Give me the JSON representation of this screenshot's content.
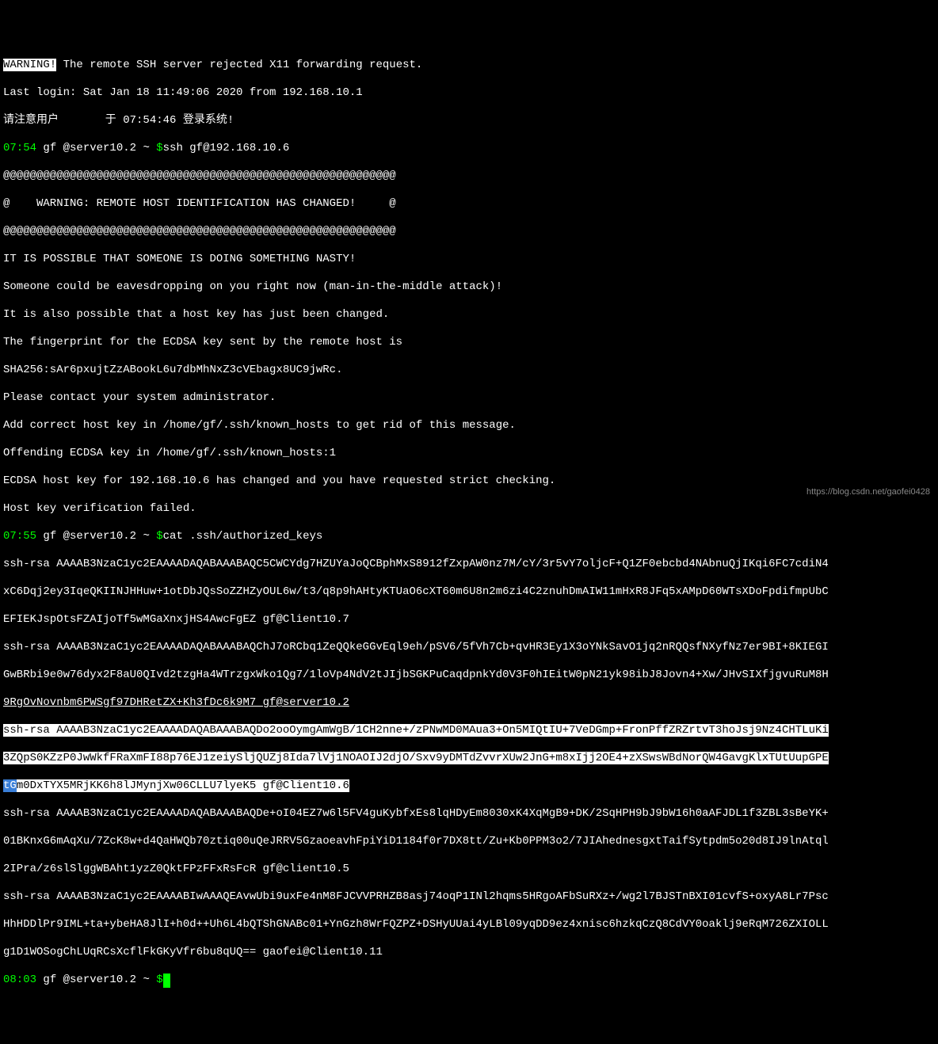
{
  "line1": {
    "warning": "WARNING!",
    "text": " The remote SSH server rejected X11 forwarding request."
  },
  "line2": "Last login: Sat Jan 18 11:49:06 2020 from 192.168.10.1",
  "line3": "请注意用户       于 07:54:46 登录系统!",
  "prompt1": {
    "time": "07:54",
    "user": " gf @server10.2 ~ ",
    "dollar": "$",
    "cmd": "ssh gf@192.168.10.6"
  },
  "warn1": "@@@@@@@@@@@@@@@@@@@@@@@@@@@@@@@@@@@@@@@@@@@@@@@@@@@@@@@@@@@",
  "warn2": "@    WARNING: REMOTE HOST IDENTIFICATION HAS CHANGED!     @",
  "warn3": "@@@@@@@@@@@@@@@@@@@@@@@@@@@@@@@@@@@@@@@@@@@@@@@@@@@@@@@@@@@",
  "msg1": "IT IS POSSIBLE THAT SOMEONE IS DOING SOMETHING NASTY!",
  "msg2": "Someone could be eavesdropping on you right now (man-in-the-middle attack)!",
  "msg3": "It is also possible that a host key has just been changed.",
  "msg4": "The fingerprint for the ECDSA key sent by the remote host is",
  "msg5": "SHA256:sAr6pxujtZzABookL6u7dbMhNxZ3cVEbagx8UC9jwRc.",
  "msg6": "Please contact your system administrator.",
  "msg7": "Add correct host key in /home/gf/.ssh/known_hosts to get rid of this message.",
  "msg8": "Offending ECDSA key in /home/gf/.ssh/known_hosts:1",
  "msg9": "ECDSA host key for 192.168.10.6 has changed and you have requested strict checking.",
  "msg10": "Host key verification failed.",
  "prompt2": {
    "time": "07:55",
    "user": " gf @server10.2 ~ ",
    "dollar": "$",
    "cmd": "cat .ssh/authorized_keys"
  },
  "key1a": "ssh-rsa AAAAB3NzaC1yc2EAAAADAQABAAABAQC5CWCYdg7HZUYaJoQCBphMxS8912fZxpAW0nz7M/cY/3r5vY7oljcF+Q1ZF0ebcbd4NAbnuQjIKqi6FC7cdiN4",
  "key1b": "xC6Dqj2ey3IqeQKIINJHHuw+1otDbJQsSoZZHZyOUL6w/t3/q8p9hAHtyKTUaO6cXT60m6U8n2m6zi4C2znuhDmAIW11mHxR8JFq5xAMpD60WTsXDoFpdifmpUbC",
  "key1c": "EFIEKJspOtsFZAIjoTf5wMGaXnxjHS4AwcFgEZ gf@Client10.7",
  "key2a": "ssh-rsa AAAAB3NzaC1yc2EAAAADAQABAAABAQChJ7oRCbq1ZeQQkeGGvEql9eh/pSV6/5fVh7Cb+qvHR3Ey1X3oYNkSavO1jq2nRQQsfNXyfNz7er9BI+8KIEGI",
  "key2b": "GwBRbi9e0w76dyx2F8aU0QIvd2tzgHa4WTrzgxWko1Qg7/1loVp4NdV2tJIjbSGKPuCaqdpnkYd0V3F0hIEitW0pN21yk98ibJ8Jovn4+Xw/JHvSIXfjgvuRuM8H",
  "key2c": "9RgOvNovnbm6PWSgf97DHRetZX+Kh3fDc6k9M7 gf@server10.2",
  "key3a": "ssh-rsa AAAAB3NzaC1yc2EAAAADAQABAAABAQDo2ooOymgAmWgB/1CH2nne+/zPNwMD0MAua3+On5MIQtIU+7VeDGmp+FronPffZRZrtvT3hoJsj9Nz4CHTLuKi",
  "key3b": "3ZQpS0KZzP0JwWkfFRaXmFI88p76EJ1zeiySljQUZj8Ida7lVj1NOAOIJ2djO/Sxv9yDMTdZvvrXUw2JnG+m8xIjj2OE4+zXSwsWBdNorQW4GavgKlxTUtUupGPE",
  "key3c_blue": "tG",
  "key3c_rest": "m0DxTYX5MRjKK6h8lJMynjXw06CLLU7lyeK5 gf@Client10.6",
  "key4a": "ssh-rsa AAAAB3NzaC1yc2EAAAADAQABAAABAQDe+oI04EZ7w6l5FV4guKybfxEs8lqHDyEm8030xK4XqMgB9+DK/2SqHPH9bJ9bW16h0aAFJDL1f3ZBL3sBeYK+",
  "key4b": "01BKnxG6mAqXu/7ZcK8w+d4QaHWQb70ztiq00uQeJRRV5GzaoeavhFpiYiD1184f0r7DX8tt/Zu+Kb0PPM3o2/7JIAhednesgxtTaifSytpdm5o20d8IJ9lnAtql",
  "key4c": "2IPra/z6slSlggWBAht1yzZ0QktFPzFFxRsFcR gf@client10.5",
  "key5a": "ssh-rsa AAAAB3NzaC1yc2EAAAABIwAAAQEAvwUbi9uxFe4nM8FJCVVPRHZB8asj74oqP1INl2hqms5HRgoAFbSuRXz+/wg2l7BJSTnBXI01cvfS+oxyA8Lr7Psc",
  "key5b": "HhHDDlPr9IML+ta+ybeHA8JlI+h0d++Uh6L4bQTShGNABc01+YnGzh8WrFQZPZ+DSHyUUai4yLBl09yqDD9ez4xnisc6hzkqCzQ8CdVY0oaklj9eRqM726ZXIOLL",
  "key5c": "g1D1WOSogChLUqRCsXcflFkGKyVfr6bu8qUQ== gaofei@Client10.11",
  "prompt3": {
    "time": "08:03",
    "user": " gf @server10.2 ~ ",
    "dollar": "$"
  },
  "watermark": "https://blog.csdn.net/gaofei0428"
}
